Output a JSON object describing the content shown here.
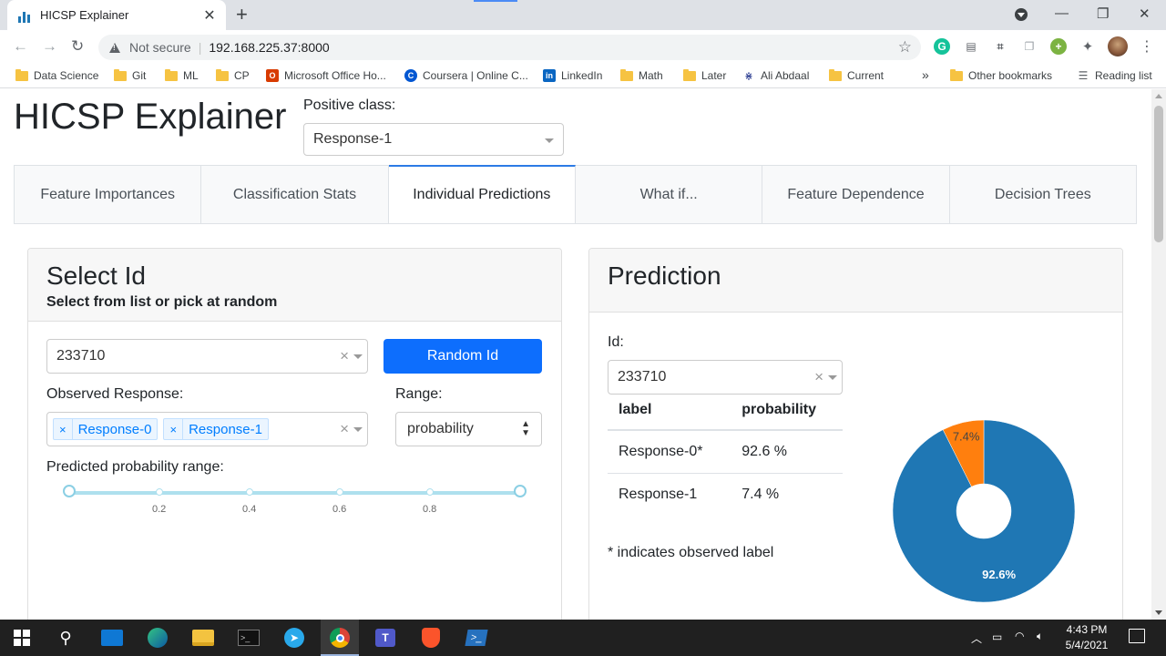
{
  "browser": {
    "tab_title": "HICSP Explainer",
    "new_tab": "+",
    "not_secure": "Not secure",
    "url": "192.168.225.37:8000",
    "bookmarks": [
      "Data Science",
      "Git",
      "ML",
      "CP",
      "Microsoft Office Ho...",
      "Coursera | Online C...",
      "LinkedIn",
      "Math",
      "Later",
      "Ali Abdaal",
      "Current"
    ],
    "bookmarks_more": "»",
    "other_bookmarks": "Other bookmarks",
    "reading_list": "Reading list"
  },
  "app": {
    "title": "HICSP Explainer",
    "positive_class_label": "Positive class:",
    "positive_class_value": "Response-1",
    "tabs": [
      "Feature Importances",
      "Classification Stats",
      "Individual Predictions",
      "What if...",
      "Feature Dependence",
      "Decision Trees"
    ],
    "active_tab": "Individual Predictions"
  },
  "select_id": {
    "title": "Select Id",
    "subtitle": "Select from list or pick at random",
    "id_value": "233710",
    "random_button": "Random Id",
    "observed_label": "Observed Response:",
    "observed_values": [
      "Response-0",
      "Response-1"
    ],
    "range_label": "Range:",
    "range_value": "probability",
    "slider_label": "Predicted probability range:",
    "slider_marks": [
      "0.2",
      "0.4",
      "0.6",
      "0.8"
    ],
    "slider_min": 0,
    "slider_max": 1
  },
  "prediction": {
    "title": "Prediction",
    "id_label": "Id:",
    "id_value": "233710",
    "table_headers": [
      "label",
      "probability"
    ],
    "rows": [
      {
        "label": "Response-0*",
        "probability": "92.6 %"
      },
      {
        "label": "Response-1",
        "probability": "7.4 %"
      }
    ],
    "footnote": "* indicates observed label"
  },
  "chart_data": {
    "type": "pie",
    "categories": [
      "Response-0",
      "Response-1"
    ],
    "values": [
      92.6,
      7.4
    ],
    "labels": [
      "92.6%",
      "7.4%"
    ],
    "colors": [
      "#1f77b4",
      "#ff7f0e"
    ],
    "hole": true
  },
  "taskbar": {
    "time": "4:43 PM",
    "date": "5/4/2021"
  }
}
